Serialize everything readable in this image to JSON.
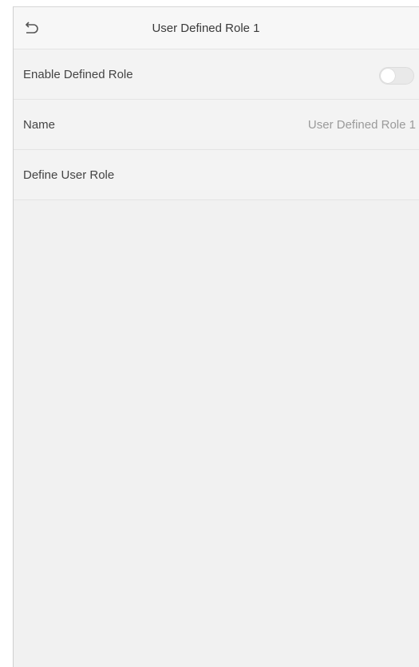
{
  "header": {
    "title": "User Defined Role 1",
    "back_icon": "back-arrow-icon"
  },
  "rows": [
    {
      "label": "Enable Defined Role",
      "control": "toggle",
      "toggle_on": false
    },
    {
      "label": "Name",
      "value": "User Defined Role 1"
    },
    {
      "label": "Define User Role"
    }
  ],
  "colors": {
    "background": "#f1f1f1",
    "header_background": "#f7f7f7",
    "label_text": "#444444",
    "value_text": "#9a9a9a"
  }
}
